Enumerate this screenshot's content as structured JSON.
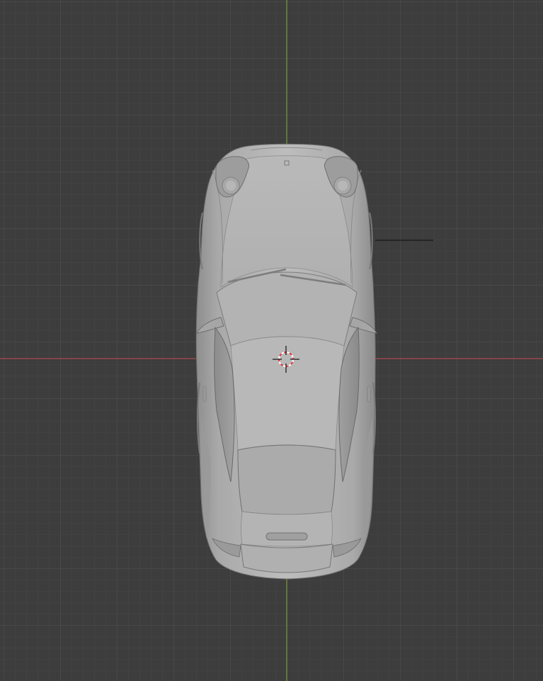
{
  "viewport": {
    "view": "top-orthographic",
    "background_color": "#3d3d3d",
    "grid": {
      "visible": true,
      "minor_color": "#474747",
      "major_color": "#535353"
    },
    "axes": {
      "x_axis_color": "#b04a52",
      "y_axis_color": "#7a9d3b"
    },
    "object": {
      "name": "car-model",
      "shading": "solid",
      "base_color": "#b5b5b5",
      "selected": false
    },
    "cursor_3d": {
      "visible": true,
      "color_ring": "#e5383b"
    }
  }
}
